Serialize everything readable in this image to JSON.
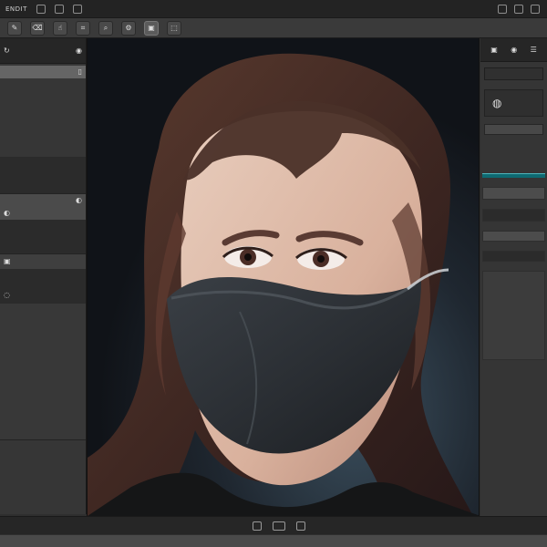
{
  "menubar": {
    "title": "ENDIT"
  },
  "toolbar": {
    "tools": [
      {
        "name": "brush",
        "glyph": "✎"
      },
      {
        "name": "eraser",
        "glyph": "⌫"
      },
      {
        "name": "hand",
        "glyph": "☝"
      },
      {
        "name": "crop",
        "glyph": "⌗"
      },
      {
        "name": "zoom",
        "glyph": "⌕"
      },
      {
        "name": "settings",
        "glyph": "⚙"
      },
      {
        "name": "layers",
        "glyph": "▣"
      },
      {
        "name": "frame",
        "glyph": "⬚"
      }
    ]
  },
  "left_panel": {
    "header": "",
    "rows": [
      "",
      "",
      "",
      "",
      "",
      "",
      "",
      ""
    ]
  },
  "right_panel": {
    "search_placeholder": "",
    "input_value": "",
    "labels": [
      "",
      ""
    ]
  },
  "canvas": {
    "subject": "portrait"
  },
  "bottom": {
    "page_text": ""
  },
  "colors": {
    "accent": "#0e6a72",
    "panel": "#353535",
    "dark": "#262626",
    "canvas": "#171b20",
    "mask": "#2b2f34",
    "skin": "#d6b4a1",
    "hair": "#4a2e25"
  }
}
